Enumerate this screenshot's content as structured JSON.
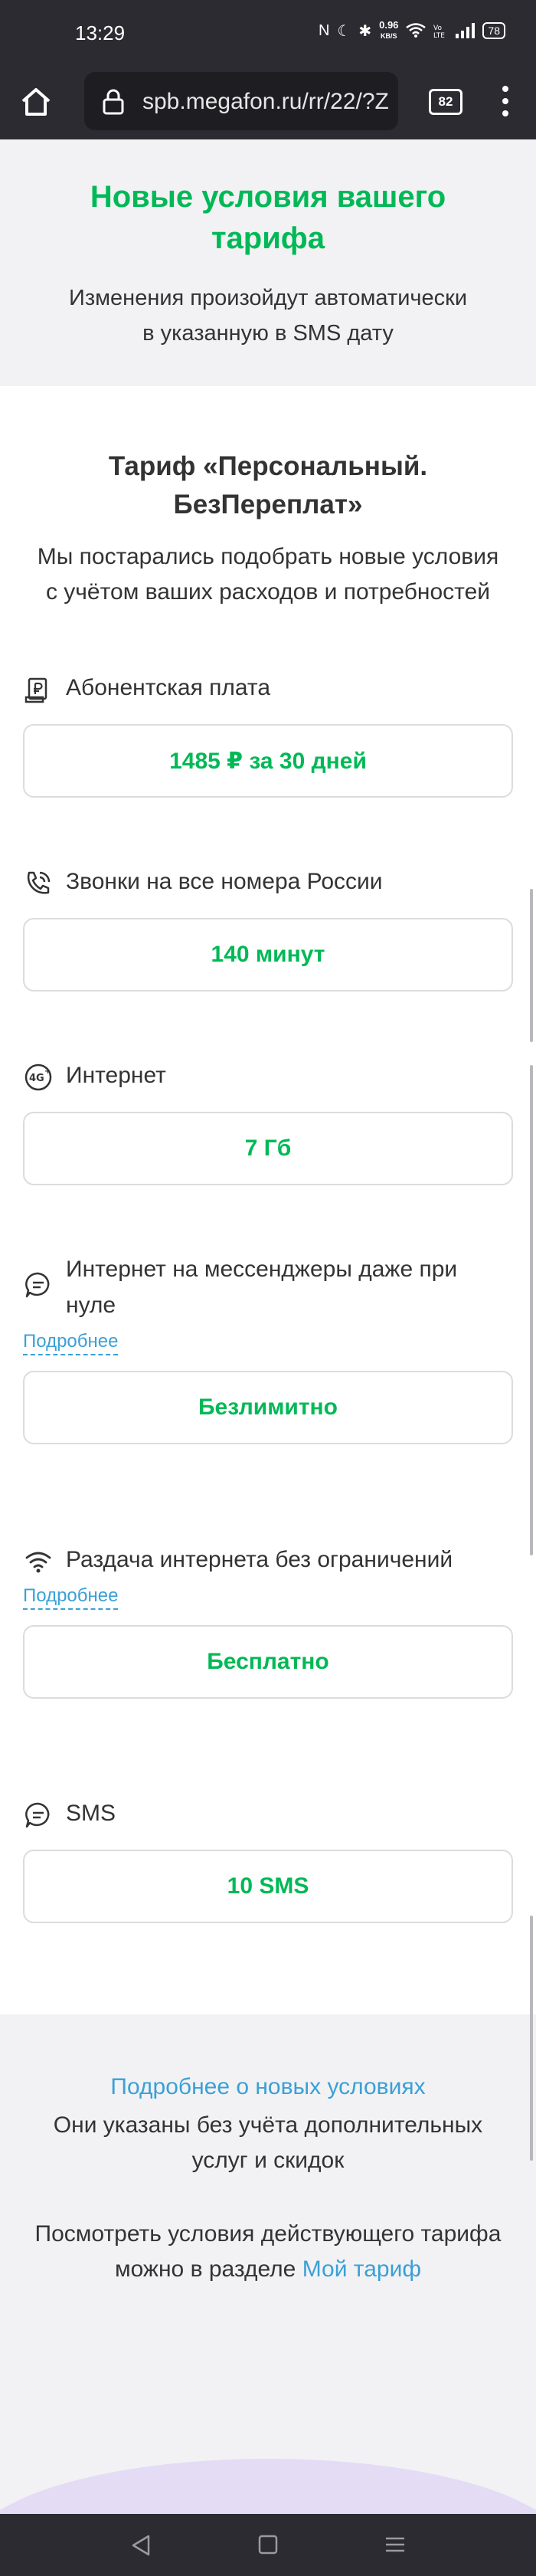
{
  "status_bar": {
    "time": "13:29",
    "speed_value": "0.96",
    "speed_unit": "KB/S",
    "battery": "78"
  },
  "browser": {
    "url": "spb.megafon.ru/rr/22/?Z",
    "tab_count": "82"
  },
  "hero": {
    "title": "Новые условия вашего тарифа",
    "subtitle_line1": "Изменения произойдут автоматически",
    "subtitle_line2": "в указанную в SMS дату"
  },
  "tariff": {
    "title_line1": "Тариф «Персональный.",
    "title_line2": "БезПереплат»",
    "desc_line1": "Мы постарались подобрать новые условия",
    "desc_line2": "с учётом ваших расходов и потребностей"
  },
  "features": [
    {
      "icon": "ruble-doc-icon",
      "label": "Абонентская плата",
      "value": "1485 ₽ за 30 дней"
    },
    {
      "icon": "phone-call-icon",
      "label": "Звонки на все номера России",
      "value": "140 минут"
    },
    {
      "icon": "4g-icon",
      "label": "Интернет",
      "value": "7 Гб"
    },
    {
      "icon": "chat-icon",
      "label_line1": "Интернет на мессенджеры даже при",
      "label_line2": "нуле",
      "more": "Подробнее",
      "value": "Безлимитно"
    },
    {
      "icon": "wifi-icon",
      "label": "Раздача интернета без ограничений",
      "more": "Подробнее",
      "value": "Бесплатно"
    },
    {
      "icon": "sms-icon",
      "label": "SMS",
      "value": "10 SMS"
    }
  ],
  "footer": {
    "more_link": "Подробнее о новых условиях",
    "note_line1": "Они указаны без учёта дополнительных",
    "note_line2": "услуг и скидок",
    "current_line1": "Посмотреть условия действующего тарифа",
    "current_line2_prefix": "можно в разделе ",
    "current_link": "Мой тариф"
  },
  "colors": {
    "accent_green": "#00b956",
    "link_blue": "#3aa0d6",
    "bar_dark": "#2b2b31"
  }
}
